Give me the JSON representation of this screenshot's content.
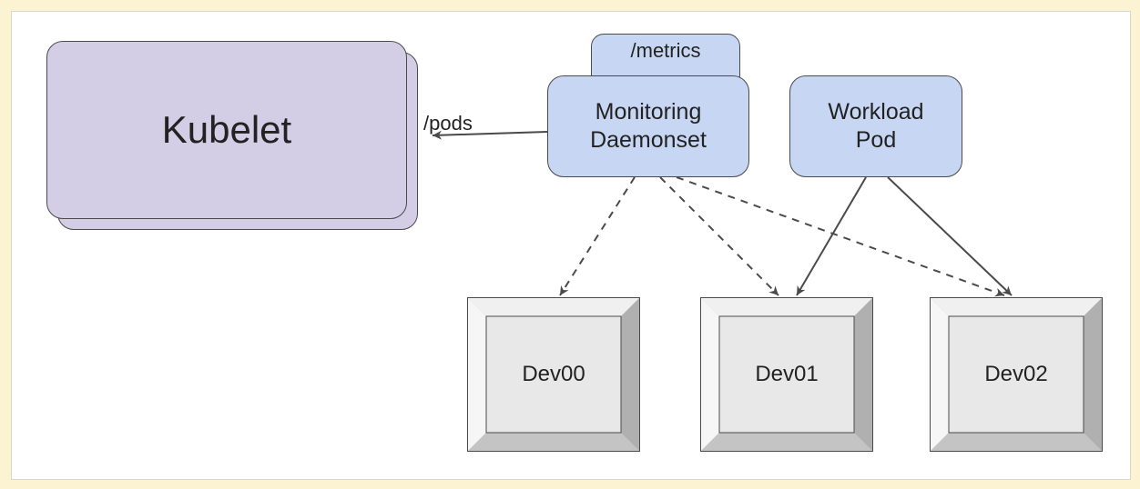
{
  "diagram": {
    "kubelet": "Kubelet",
    "pods_endpoint": "/pods",
    "metrics_endpoint": "/metrics",
    "monitoring_daemonset": "Monitoring\nDaemonset",
    "workload_pod": "Workload\nPod",
    "devices": [
      "Dev00",
      "Dev01",
      "Dev02"
    ]
  },
  "connections": [
    {
      "from": "monitoring_daemonset",
      "to": "kubelet",
      "label": "/pods",
      "style": "solid"
    },
    {
      "from": "monitoring_daemonset",
      "to": "Dev00",
      "style": "dashed"
    },
    {
      "from": "monitoring_daemonset",
      "to": "Dev01",
      "style": "dashed"
    },
    {
      "from": "monitoring_daemonset",
      "to": "Dev02",
      "style": "dashed"
    },
    {
      "from": "workload_pod",
      "to": "Dev01",
      "style": "solid"
    },
    {
      "from": "workload_pod",
      "to": "Dev02",
      "style": "solid"
    },
    {
      "from": "monitoring_daemonset",
      "to": "metrics_endpoint",
      "style": "attached"
    }
  ],
  "colors": {
    "purple_fill": "#d3cde6",
    "blue_fill": "#c7d7f3",
    "device_fill": "#e8e8e8",
    "device_bevel_light": "#f4f4f4",
    "device_bevel_dark": "#b8b8b8",
    "stroke": "#4a4a4a",
    "canvas_bg": "#fcf3d3"
  }
}
